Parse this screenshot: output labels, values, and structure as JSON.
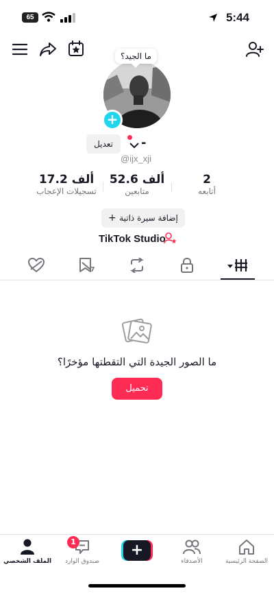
{
  "status_bar": {
    "time": "5:44",
    "battery": "65",
    "icons": [
      "signal-icon",
      "wifi-icon",
      "location-icon"
    ]
  },
  "toolbar": {
    "icons": [
      "add-user-icon",
      "menu-icon",
      "share-icon",
      "calendar-star-icon"
    ]
  },
  "profile": {
    "bubble_text": "ما الجيد؟",
    "edit_label": "تعديل",
    "name": "-",
    "username": "@ijx_xji",
    "stats": [
      {
        "value": "2",
        "label": "أتابعه"
      },
      {
        "value": "52.6 ألف",
        "label": "متابعين"
      },
      {
        "value": "17.2 ألف",
        "label": "تسجيلات الإعجاب"
      }
    ],
    "bio_button": "إضافة سيرة ذاتية",
    "studio_link": "TikTok Studio"
  },
  "tabs": {
    "icons": [
      "videos-grid-icon",
      "lock-icon",
      "repost-icon",
      "favorites-icon",
      "liked-icon"
    ],
    "active": "videos-grid-icon"
  },
  "empty_state": {
    "title": "ما الصور الجيدة التي التقطتها مؤخرًا؟",
    "upload_label": "تحميل"
  },
  "bottom_nav": {
    "items": [
      {
        "label": "الملف الشخصي",
        "icon": "profile-icon",
        "active": true
      },
      {
        "label": "صندوق الوارد",
        "icon": "inbox-icon",
        "active": false
      },
      {
        "label": "",
        "icon": "create-plus-icon",
        "active": false
      },
      {
        "label": "الأصدقاء",
        "icon": "friends-icon",
        "active": false
      },
      {
        "label": "الصفحة الرئيسية",
        "icon": "home-icon",
        "active": false
      }
    ],
    "inbox_badge": "1"
  },
  "colors": {
    "accent": "#fe2c55",
    "cyan": "#20d5ec",
    "text": "#161823",
    "muted": "#75767c"
  }
}
